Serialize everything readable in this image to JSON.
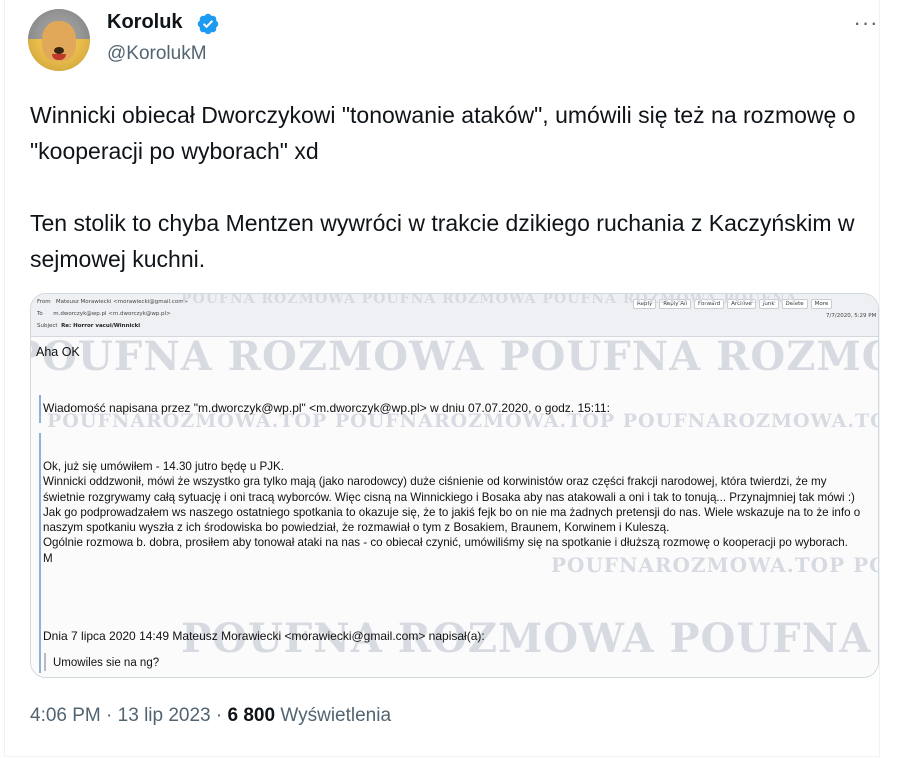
{
  "author": {
    "name": "Koroluk",
    "handle": "@KorolukM",
    "verified": true,
    "verified_color": "#1d9bf0"
  },
  "more_icon": "···",
  "tweet": {
    "text": "Winnicki obiecał Dworczykowi \"tonowanie ataków\", umówili się też na rozmowę o \"kooperacji po wyborach\" xd\n\nTen stolik to chyba Mentzen wywróci w trakcie dzikiego ruchania z Kaczyńskim w sejmowej kuchni."
  },
  "email": {
    "from_label": "From",
    "from": "Mateusz Morawiecki <morawiecki@gmail.com>",
    "to_label": "To",
    "to": "m.dworczyk@wp.pl <m.dworczyk@wp.pl>",
    "subject_label": "Subject",
    "subject": "Re: Horror vacui/Winnicki",
    "date": "7/7/2020, 5:29 PM",
    "toolbar": [
      "Reply",
      "Reply All",
      "Forward",
      "Archive",
      "Junk",
      "Delete",
      "More"
    ],
    "greeting": "Aha OK",
    "quoted_header": "Wiadomość napisana przez \"m.dworczyk@wp.pl\" <m.dworczyk@wp.pl> w dniu 07.07.2020, o godz. 15:11:",
    "body": "Ok, już się umówiłem - 14.30 jutro będę u PJK.\nWinnicki oddzwonił, mówi że wszystko gra tylko mają (jako narodowcy) duże ciśnienie od korwinistów oraz części frakcji narodowej, która twierdzi, że my świetnie rozgrywamy całą sytuację i oni tracą wyborców. Więc cisną na Winnickiego i Bosaka aby nas atakowali a oni i tak to tonują... Przynajmniej tak mówi :)\nJak go podprowadzałem ws naszego ostatniego spotkania to okazuje się, że to jakiś fejk bo on nie ma żadnych pretensji do nas. Wiele wskazuje na to że info o naszym spotkaniu wyszła z ich środowiska bo powiedział, że rozmawiał o tym z Bosakiem, Braunem, Korwinem i Kuleszą.\nOgólnie rozmowa b. dobra, prosiłem aby tonował ataki na nas - co obiecał czynić, umówiliśmy się na spotkanie i dłuższą rozmowę o kooperacji po wyborach.\nM",
    "quoted_footer": "Dnia 7 lipca 2020 14:49 Mateusz Morawiecki <morawiecki@gmail.com> napisał(a):",
    "last_quote": "Umowiles sie na ng?",
    "watermark_large": "POUFNA ROZMOWA POUFNA ROZMOWA POUFNA ROZMOWA POUFNA",
    "watermark_small": "POUFNAROZMOWA.TOP  POUFNAROZMOWA.TOP  POUFNAROZMOWA.TOP  POUFNAROZMOWA.TOP"
  },
  "meta": {
    "time": "4:06 PM",
    "separator": "·",
    "date": "13 lip 2023",
    "views_count": "6 800",
    "views_label": "Wyświetlenia"
  }
}
